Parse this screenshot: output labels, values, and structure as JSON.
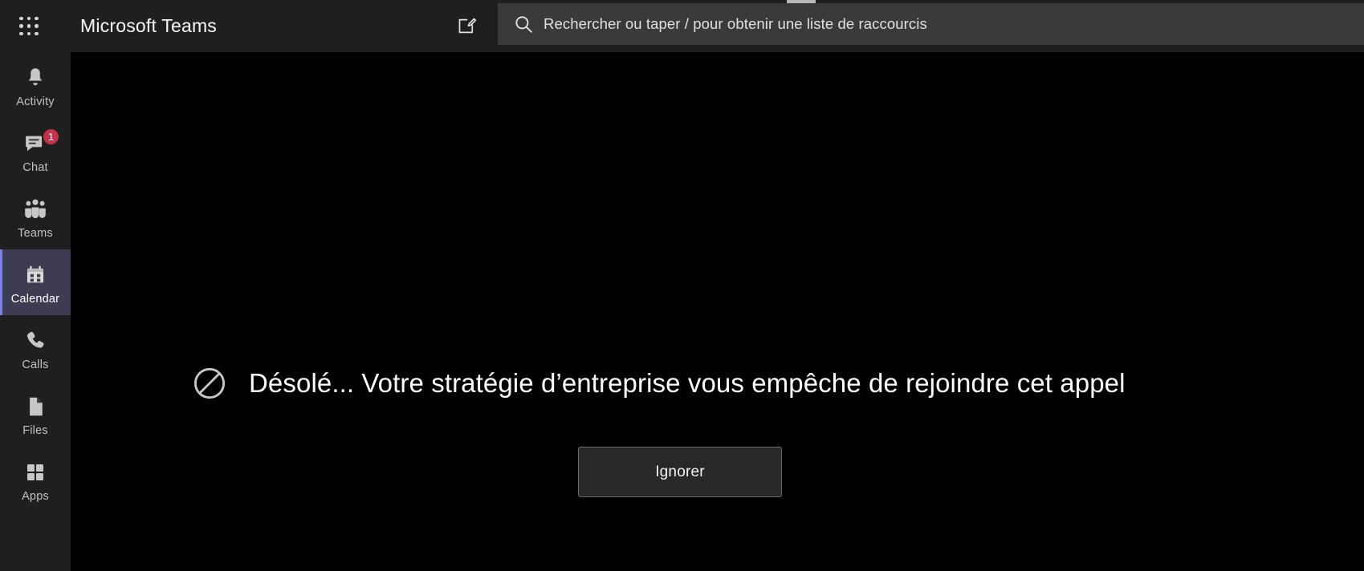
{
  "window": {
    "app_title": "Microsoft Teams"
  },
  "header": {
    "waffle_icon": "app-launcher-waffle-icon",
    "compose_icon": "new-chat-compose-icon",
    "search": {
      "icon": "search-icon",
      "value": "",
      "placeholder": "Rechercher ou taper / pour obtenir une liste de raccourcis"
    }
  },
  "sidebar": {
    "items": [
      {
        "label": "Activity",
        "icon": "bell-icon",
        "selected": false,
        "badge": ""
      },
      {
        "label": "Chat",
        "icon": "chat-icon",
        "selected": false,
        "badge": "1"
      },
      {
        "label": "Teams",
        "icon": "teams-icon",
        "selected": false,
        "badge": ""
      },
      {
        "label": "Calendar",
        "icon": "calendar-icon",
        "selected": true,
        "badge": ""
      },
      {
        "label": "Calls",
        "icon": "phone-icon",
        "selected": false,
        "badge": ""
      },
      {
        "label": "Files",
        "icon": "file-icon",
        "selected": false,
        "badge": ""
      },
      {
        "label": "Apps",
        "icon": "apps-grid-icon",
        "selected": false,
        "badge": ""
      }
    ]
  },
  "main": {
    "status_icon": "blocked-prohibition-icon",
    "message": "Désolé... Votre stratégie d’entreprise vous empêche de rejoindre cet appel",
    "dismiss_label": "Ignorer"
  },
  "colors": {
    "rail_bg": "#201f1f",
    "selected_item_bg": "#3d3c53",
    "selected_accent": "#7b83eb",
    "badge_red": "#c4314b",
    "search_bg": "#3b3a39",
    "content_bg": "#000000",
    "button_bg": "#292828",
    "button_border": "#6e6d6b"
  }
}
